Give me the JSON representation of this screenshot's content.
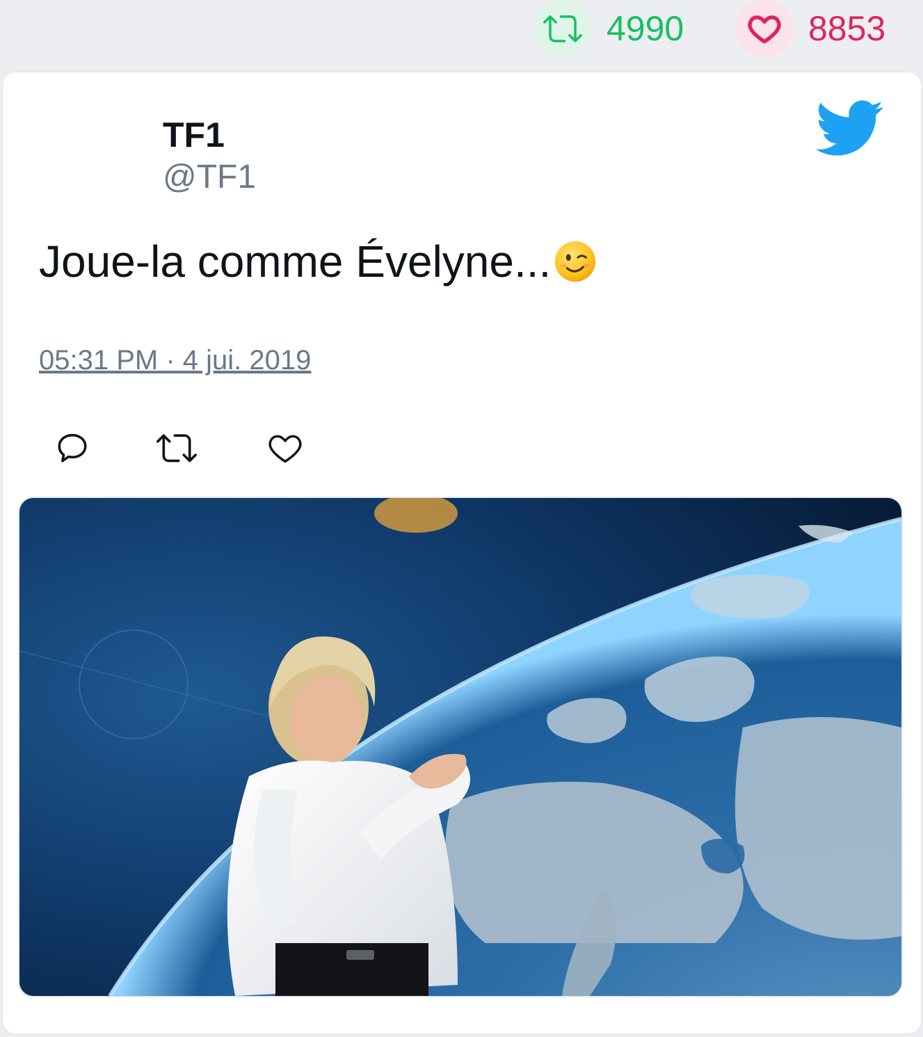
{
  "stats": {
    "retweets": {
      "count": "4990",
      "icon": "retweet-icon",
      "color": "#17bf63",
      "bg": "#dff5ea"
    },
    "likes": {
      "count": "8853",
      "icon": "heart-icon",
      "color": "#e0245e",
      "bg": "#fbe3eb"
    }
  },
  "tweet": {
    "author_name": "TF1",
    "author_handle": "@TF1",
    "text": "Joue-la comme Évelyne...",
    "emoji": "winking-face",
    "timestamp": "05:31 PM · 4 jui. 2019",
    "actions": [
      {
        "icon": "reply-icon"
      },
      {
        "icon": "retweet-icon"
      },
      {
        "icon": "like-icon"
      }
    ],
    "media": {
      "type": "gif",
      "description_icon": "weather-presenter-earth-image"
    }
  },
  "colors": {
    "twitter_blue": "#1da1f2",
    "text_primary": "#0f1419",
    "text_secondary": "#6a7986"
  }
}
